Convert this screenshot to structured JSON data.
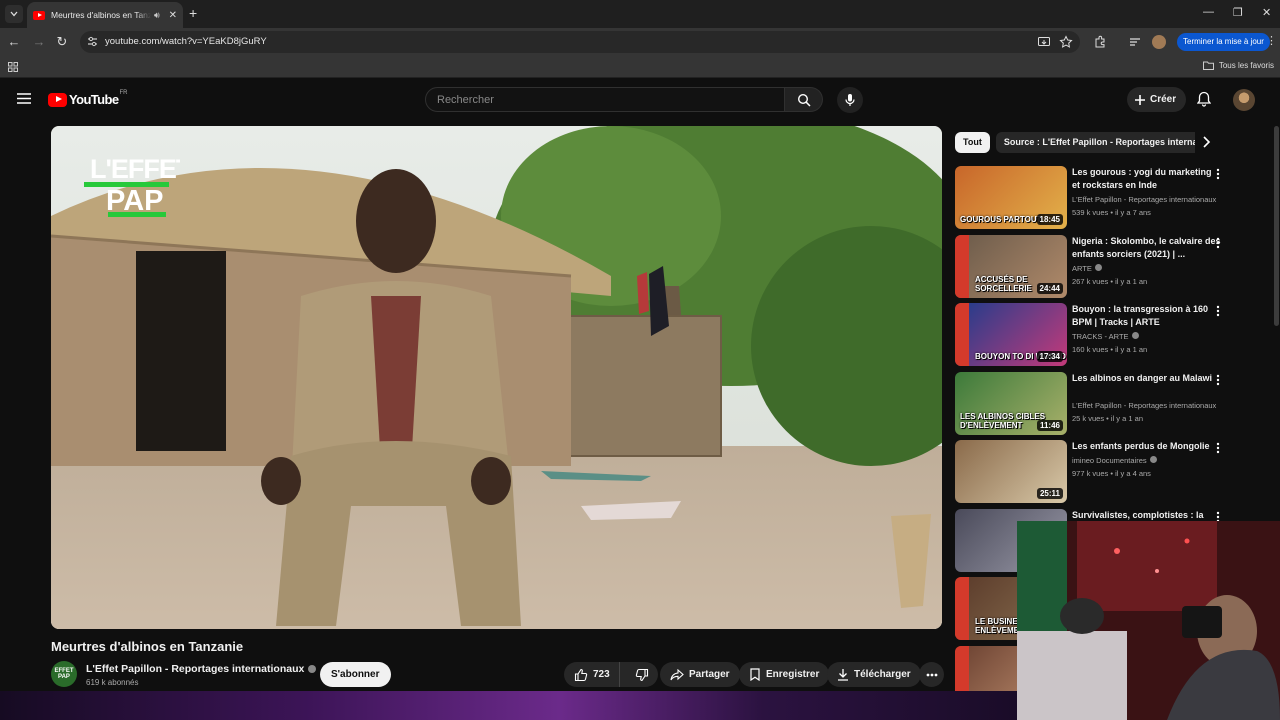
{
  "browser": {
    "tab_title": "Meurtres d'albinos en Tanzanie - YouTube",
    "url": "youtube.com/watch?v=YEaKD8jGuRY",
    "update_button": "Terminer la mise à jour",
    "bookmarks_all": "Tous les favoris"
  },
  "header": {
    "logo_text": "YouTube",
    "logo_country": "FR",
    "search_placeholder": "Rechercher",
    "create_label": "Créer"
  },
  "video": {
    "watermark_line1": "L'EFFET",
    "watermark_line2": "PAP",
    "title": "Meurtres d'albinos en Tanzanie",
    "channel_name": "L'Effet Papillon - Reportages internationaux",
    "channel_avatar_text": "EFFET PAP",
    "subscribers": "619 k abonnés",
    "subscribe_label": "S'abonner",
    "likes": "723",
    "share_label": "Partager",
    "save_label": "Enregistrer",
    "download_label": "Télécharger"
  },
  "chips": [
    "Tout",
    "Source : L'Effet Papillon - Reportages internationaux"
  ],
  "recommendations": [
    {
      "title": "Les gourous : yogi du marketing et rockstars en Inde",
      "channel": "L'Effet Papillon - Reportages internationaux",
      "meta": "539 k vues • il y a 7 ans",
      "duration": "18:45",
      "overlay": "GOUROUS PARTOUT",
      "colors": [
        "#c8662a",
        "#e3b14a"
      ],
      "verified": false,
      "arte": false
    },
    {
      "title": "Nigeria : Skolombo, le calvaire des enfants sorciers (2021) | ...",
      "channel": "ARTE",
      "meta": "267 k vues • il y a 1 an",
      "duration": "24:44",
      "overlay": "ACCUSÉS DE SORCELLERIE",
      "colors": [
        "#6a5a4a",
        "#b08a6a"
      ],
      "verified": true,
      "arte": true
    },
    {
      "title": "Bouyon : la transgression à 160 BPM | Tracks | ARTE",
      "channel": "TRACKS - ARTE",
      "meta": "160 k vues • il y a 1 an",
      "duration": "17:34",
      "overlay": "BOUYON TO DI WORLD",
      "colors": [
        "#1d3d8c",
        "#c43a7a"
      ],
      "verified": true,
      "arte": true
    },
    {
      "title": "Les albinos en danger au Malawi",
      "channel": "L'Effet Papillon - Reportages internationaux",
      "meta": "25 k vues • il y a 1 an",
      "duration": "11:46",
      "overlay": "LES ALBINOS CIBLES D'ENLÈVEMENT",
      "colors": [
        "#3c7a3a",
        "#a8b06a"
      ],
      "verified": false,
      "arte": false
    },
    {
      "title": "Les enfants perdus de Mongolie",
      "channel": "imineo Documentaires",
      "meta": "977 k vues • il y a 4 ans",
      "duration": "25:11",
      "overlay": "",
      "colors": [
        "#8a6a4a",
        "#d8c8a8"
      ],
      "verified": true,
      "arte": false
    },
    {
      "title": "Survivalistes, complotistes : la",
      "channel": "",
      "meta": "",
      "duration": "",
      "overlay": "",
      "colors": [
        "#4a4a5a",
        "#9a9aa8"
      ],
      "verified": false,
      "arte": false
    },
    {
      "title": "",
      "channel": "",
      "meta": "",
      "duration": "",
      "overlay": "LE BUSINESS DES ENLÈVEMENTS",
      "colors": [
        "#5a3a2a",
        "#8a7050"
      ],
      "verified": false,
      "arte": true
    },
    {
      "title": "",
      "channel": "",
      "meta": "",
      "duration": "",
      "overlay": "",
      "colors": [
        "#6a4030",
        "#c09070"
      ],
      "verified": false,
      "arte": true
    }
  ]
}
